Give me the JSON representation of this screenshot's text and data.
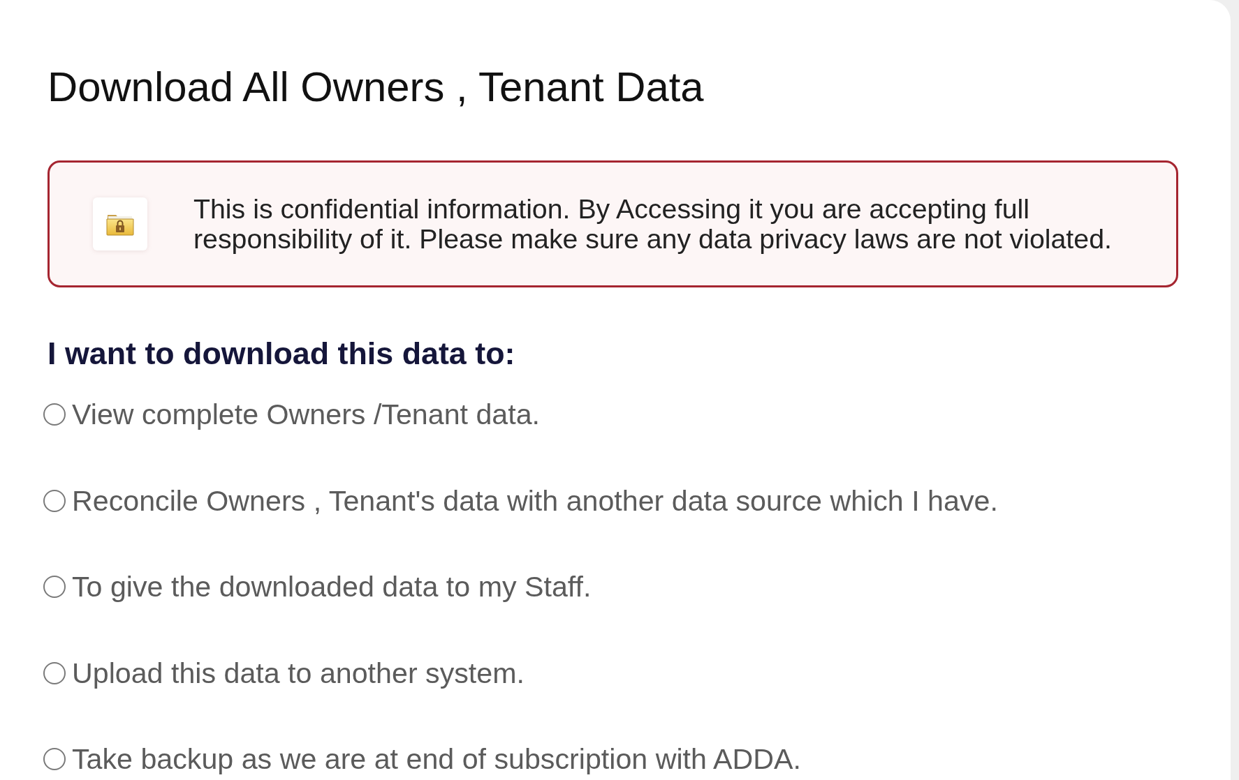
{
  "title": "Download All Owners , Tenant Data",
  "notice": {
    "text": "This is confidential information. By Accessing it you are accepting full responsibility of it. Please make sure any data privacy laws are not violated."
  },
  "question": "I want to download this data to:",
  "options": [
    {
      "label": "View complete Owners /Tenant data.",
      "selected": false
    },
    {
      "label": "Reconcile Owners , Tenant's data with another data source which I have.",
      "selected": false
    },
    {
      "label": "To give the downloaded data to my Staff.",
      "selected": false
    },
    {
      "label": "Upload this data to another system.",
      "selected": false
    },
    {
      "label": "Take backup as we are at end of subscription with ADDA.",
      "selected": false
    }
  ]
}
